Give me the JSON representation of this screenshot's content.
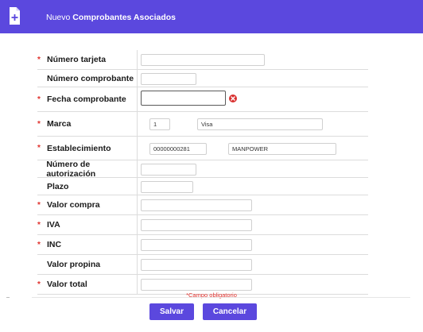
{
  "header": {
    "prefix": "Nuevo",
    "title": "Comprobantes Asociados"
  },
  "fields": [
    {
      "label": "Número tarjeta",
      "required": true
    },
    {
      "label": "Número comprobante",
      "required": false
    },
    {
      "label": "Fecha comprobante",
      "required": true,
      "error": true
    },
    {
      "label": "Marca",
      "required": true,
      "code": "1",
      "name": "Visa"
    },
    {
      "label": "Establecimiento",
      "required": true,
      "code": "00000000281",
      "name": "MANPOWER"
    },
    {
      "label": "Número de autorización",
      "required": false
    },
    {
      "label": "Plazo",
      "required": false
    },
    {
      "label": "Valor compra",
      "required": true
    },
    {
      "label": "IVA",
      "required": true
    },
    {
      "label": "INC",
      "required": true
    },
    {
      "label": "Valor propina",
      "required": false
    },
    {
      "label": "Valor total",
      "required": true
    }
  ],
  "required_star": "*",
  "required_note": "*Campo obligatorio",
  "buttons": {
    "save": "Salvar",
    "cancel": "Cancelar"
  },
  "colors": {
    "primary": "#5b48de",
    "required": "#e0322e",
    "error_icon": "#d9302f"
  },
  "icons": {
    "header": "document-add-icon",
    "error": "clear-error-icon"
  }
}
